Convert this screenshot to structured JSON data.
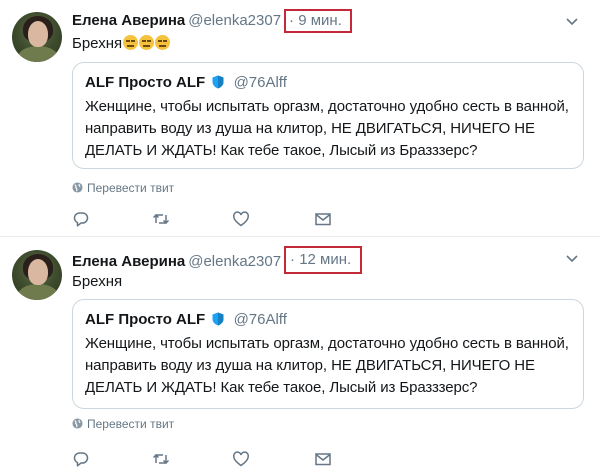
{
  "tweets": [
    {
      "author_name": "Елена Аверина",
      "author_handle": "@elenka2307",
      "time": "· 9 мин.",
      "text": "Брехня",
      "emoji_count": 3,
      "quote": {
        "name": "ALF Просто ALF",
        "handle": "@76Alff",
        "text": "Женщине, чтобы испытать оргазм, достаточно удобно сесть в ванной, направить воду из душа на клитор, НЕ ДВИГАТЬСЯ, НИЧЕГО НЕ ДЕЛАТЬ И ЖДАТЬ! Как тебе такое, Лысый из Бразззерс?"
      },
      "translate_label": "Перевести твит"
    },
    {
      "author_name": "Елена Аверина",
      "author_handle": "@elenka2307",
      "time": "· 12 мин.",
      "text": "Брехня",
      "emoji_count": 0,
      "quote": {
        "name": "ALF Просто ALF",
        "handle": "@76Alff",
        "text": "Женщине, чтобы испытать оргазм, достаточно удобно сесть в ванной, направить воду из душа на клитор, НЕ ДВИГАТЬСЯ, НИЧЕГО НЕ ДЕЛАТЬ И ЖДАТЬ! Как тебе такое, Лысый из Бразззерс?"
      },
      "translate_label": "Перевести твит"
    }
  ],
  "icons": {
    "reply": "reply-icon",
    "retweet": "retweet-icon",
    "like": "like-icon",
    "dm": "envelope-icon",
    "caret": "chevron-down-icon",
    "verified": "verified-badge-icon",
    "globe": "globe-icon"
  },
  "colors": {
    "highlight_box": "#c4293a",
    "muted": "#657786",
    "verified": "#1da1f2",
    "border": "#ccd6dd"
  }
}
